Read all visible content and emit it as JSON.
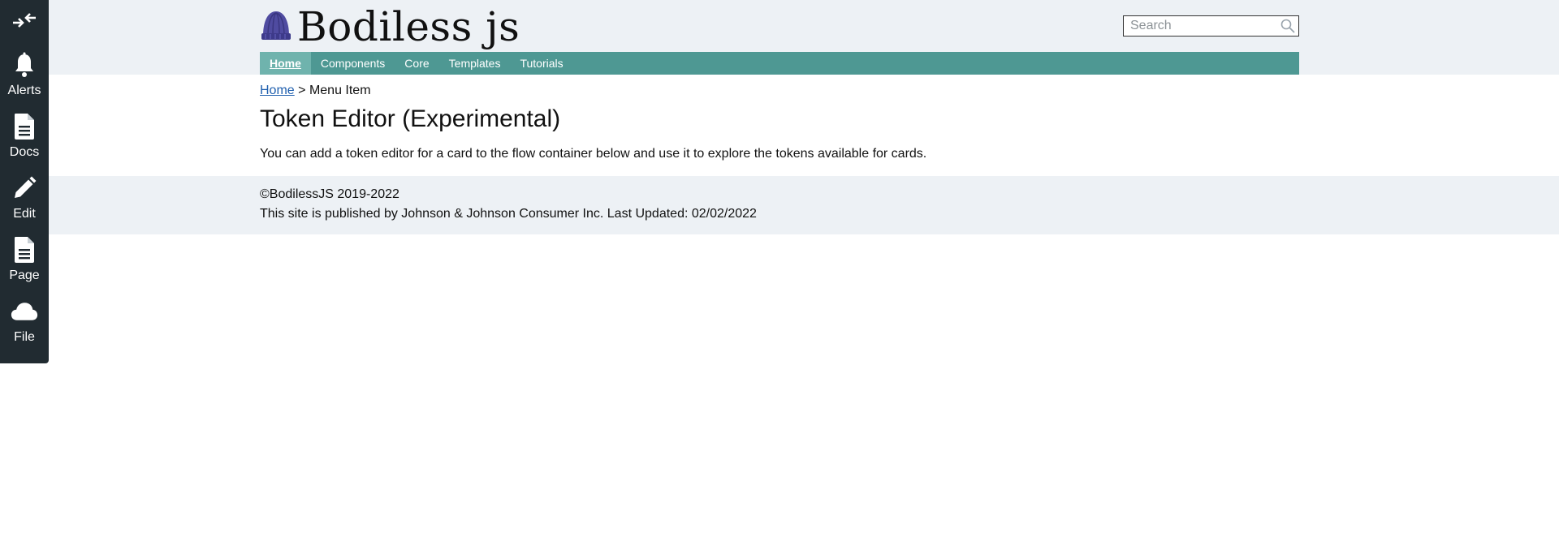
{
  "sidebar": {
    "collapse_icon": "collapse-arrows-icon",
    "items": [
      {
        "label": "Alerts",
        "icon": "bell-icon"
      },
      {
        "label": "Docs",
        "icon": "document-icon"
      },
      {
        "label": "Edit",
        "icon": "pencil-icon"
      },
      {
        "label": "Page",
        "icon": "page-icon"
      },
      {
        "label": "File",
        "icon": "cloud-icon"
      }
    ]
  },
  "header": {
    "logo_text": "Bodiless js",
    "logo_icon": "beanie-hat-icon",
    "search": {
      "placeholder": "Search",
      "value": "",
      "icon": "search-icon"
    }
  },
  "nav": {
    "items": [
      {
        "label": "Home",
        "active": true
      },
      {
        "label": "Components",
        "active": false
      },
      {
        "label": "Core",
        "active": false
      },
      {
        "label": "Templates",
        "active": false
      },
      {
        "label": "Tutorials",
        "active": false
      }
    ]
  },
  "breadcrumb": {
    "home": "Home",
    "separator": ">",
    "current": "Menu Item"
  },
  "main": {
    "title": "Token Editor (Experimental)",
    "intro": "You can add a token editor for a card to the flow container below and use it to explore the tokens available for cards."
  },
  "footer": {
    "copyright": "©BodilessJS 2019-2022",
    "published": "This site is published by Johnson & Johnson Consumer Inc. Last Updated: 02/02/2022"
  },
  "colors": {
    "sidebar_bg": "#212b31",
    "header_bg": "#edf1f5",
    "nav_bg": "#4e9893",
    "nav_active_bg": "#6fb3ad",
    "link": "#1f5fae",
    "logo_hat": "#4a4a9e"
  }
}
